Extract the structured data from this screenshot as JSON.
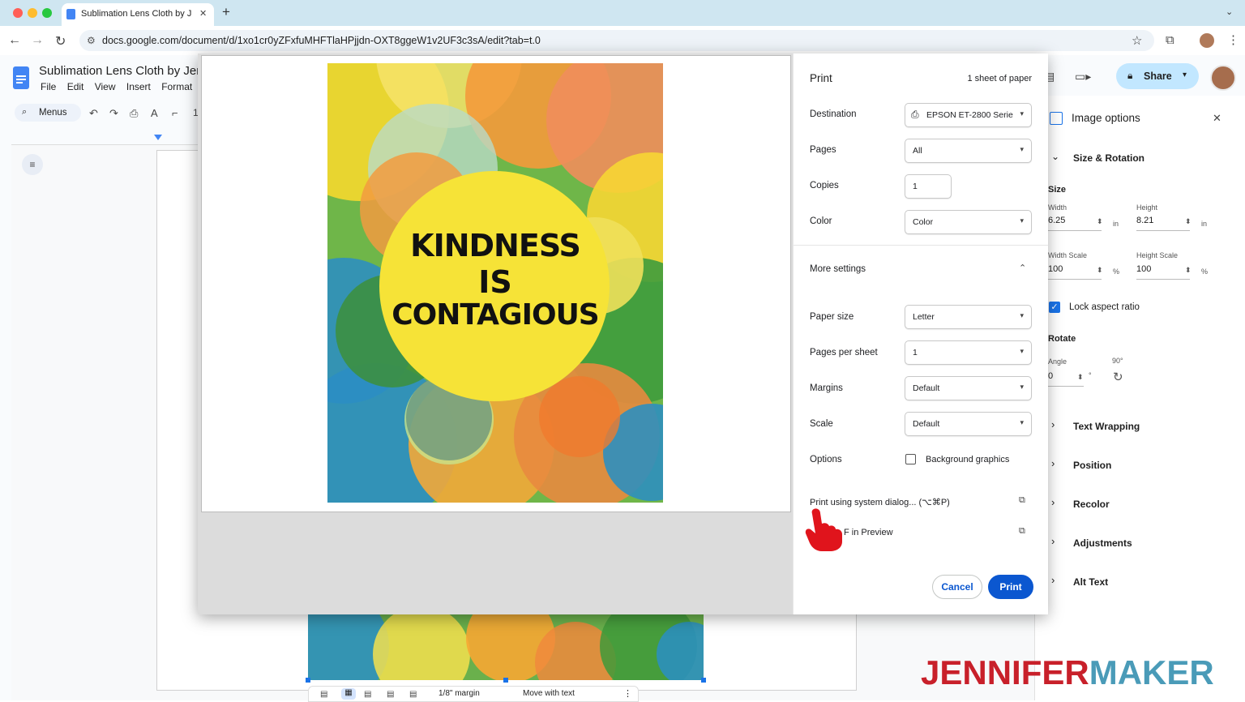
{
  "browser": {
    "tab_title": "Sublimation Lens Cloth by Je",
    "url": "docs.google.com/document/d/1xo1cr0yZFxfuMHFTlaHPjjdn-OXT8ggeW1v2UF3c3sA/edit?tab=t.0",
    "new_tab_glyph": "+",
    "close_glyph": "✕"
  },
  "docs": {
    "title": "Sublimation Lens Cloth by Jen",
    "menus": [
      "File",
      "Edit",
      "View",
      "Insert",
      "Format"
    ],
    "menus_search": "Menus",
    "zoom_partial": "1",
    "share_label": "Share"
  },
  "image_toolbar": {
    "margin_label": "1/8\" margin",
    "wrap_label": "Move with text"
  },
  "side_panel": {
    "title": "Image options",
    "size_rotation": "Size & Rotation",
    "size_label": "Size",
    "width_label": "Width",
    "width_value": "6.25",
    "height_label": "Height",
    "height_value": "8.21",
    "unit_in": "in",
    "width_scale_label": "Width Scale",
    "width_scale_value": "100",
    "height_scale_label": "Height Scale",
    "height_scale_value": "100",
    "unit_pct": "%",
    "lock_label": "Lock aspect ratio",
    "rotate_label": "Rotate",
    "angle_label": "Angle",
    "angle_value": "0",
    "deg": "°",
    "rot90": "90°",
    "sections": [
      "Text Wrapping",
      "Position",
      "Recolor",
      "Adjustments",
      "Alt Text"
    ]
  },
  "print": {
    "title": "Print",
    "sheets": "1 sheet of paper",
    "destination_label": "Destination",
    "destination_value": "EPSON ET-2800 Serie",
    "pages_label": "Pages",
    "pages_value": "All",
    "copies_label": "Copies",
    "copies_value": "1",
    "color_label": "Color",
    "color_value": "Color",
    "more_settings": "More settings",
    "paper_size_label": "Paper size",
    "paper_size_value": "Letter",
    "pps_label": "Pages per sheet",
    "pps_value": "1",
    "margins_label": "Margins",
    "margins_value": "Default",
    "scale_label": "Scale",
    "scale_value": "Default",
    "options_label": "Options",
    "bg_graphics": "Background graphics",
    "system_dialog": "Print using system dialog... (⌥⌘P)",
    "open_pdf": "F in Preview",
    "cancel": "Cancel",
    "print_btn": "Print"
  },
  "artwork": {
    "line1": "KINDNESS",
    "line2": "IS",
    "line3": "CONTAGIOUS"
  },
  "watermark": {
    "part1": "JENNIFER",
    "part2": "MAKER",
    "color1": "#c8202a",
    "color2": "#4a9bb8"
  }
}
